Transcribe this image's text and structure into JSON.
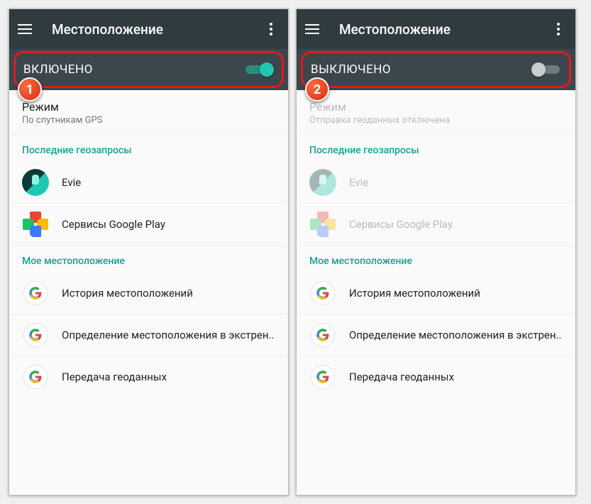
{
  "screens": [
    {
      "badge": "1",
      "title": "Местоположение",
      "toggle": {
        "label": "ВКЛЮЧЕНО",
        "on": true
      },
      "mode": {
        "title": "Режим",
        "sub": "По спутникам GPS",
        "disabled": false
      },
      "section_recent": "Последние геозапросы",
      "recent": [
        {
          "label": "Evie",
          "icon": "evie",
          "dimmed": false
        },
        {
          "label": "Сервисы Google Play",
          "icon": "gplay",
          "dimmed": false
        }
      ],
      "section_myloc": "Мое местоположение",
      "myloc": [
        {
          "label": "История местоположений",
          "icon": "google"
        },
        {
          "label": "Определение местоположения в экстрен..",
          "icon": "google"
        },
        {
          "label": "Передача геоданных",
          "icon": "google"
        }
      ]
    },
    {
      "badge": "2",
      "title": "Местоположение",
      "toggle": {
        "label": "ВЫКЛЮЧЕНО",
        "on": false
      },
      "mode": {
        "title": "Режим",
        "sub": "Отправка геоданных отключена",
        "disabled": true
      },
      "section_recent": "Последние геозапросы",
      "recent": [
        {
          "label": "Evie",
          "icon": "evie",
          "dimmed": true
        },
        {
          "label": "Сервисы Google Play",
          "icon": "gplay",
          "dimmed": true
        }
      ],
      "section_myloc": "Мое местоположение",
      "myloc": [
        {
          "label": "История местоположений",
          "icon": "google"
        },
        {
          "label": "Определение местоположения в экстрен..",
          "icon": "google"
        },
        {
          "label": "Передача геоданных",
          "icon": "google"
        }
      ]
    }
  ]
}
